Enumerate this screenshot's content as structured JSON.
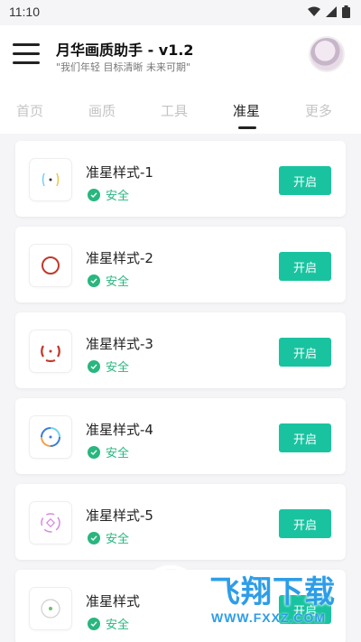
{
  "status_bar": {
    "time": "11:10"
  },
  "header": {
    "title": "月华画质助手 - v1.2",
    "subtitle": "\"我们年轻 目标清晰 未来可期\""
  },
  "tabs": [
    {
      "label": "首页",
      "active": false
    },
    {
      "label": "画质",
      "active": false
    },
    {
      "label": "工具",
      "active": false
    },
    {
      "label": "准星",
      "active": true
    },
    {
      "label": "更多",
      "active": false
    }
  ],
  "items": [
    {
      "title": "准星样式-1",
      "status": "安全",
      "button": "开启",
      "accent": "#f0c24a"
    },
    {
      "title": "准星样式-2",
      "status": "安全",
      "button": "开启",
      "accent": "#c0392b"
    },
    {
      "title": "准星样式-3",
      "status": "安全",
      "button": "开启",
      "accent": "#c0392b"
    },
    {
      "title": "准星样式-4",
      "status": "安全",
      "button": "开启",
      "accent": "#3a7bd5"
    },
    {
      "title": "准星样式-5",
      "status": "安全",
      "button": "开启",
      "accent": "#d58ae0"
    },
    {
      "title": "准星样式",
      "status": "安全",
      "button": "开启",
      "accent": "#6ac26a"
    }
  ],
  "watermark": {
    "main": "飞翔下载",
    "url": "WWW.FXXZ.COM"
  },
  "colors": {
    "accent_button": "#19c3a0",
    "safe": "#29b67f"
  }
}
